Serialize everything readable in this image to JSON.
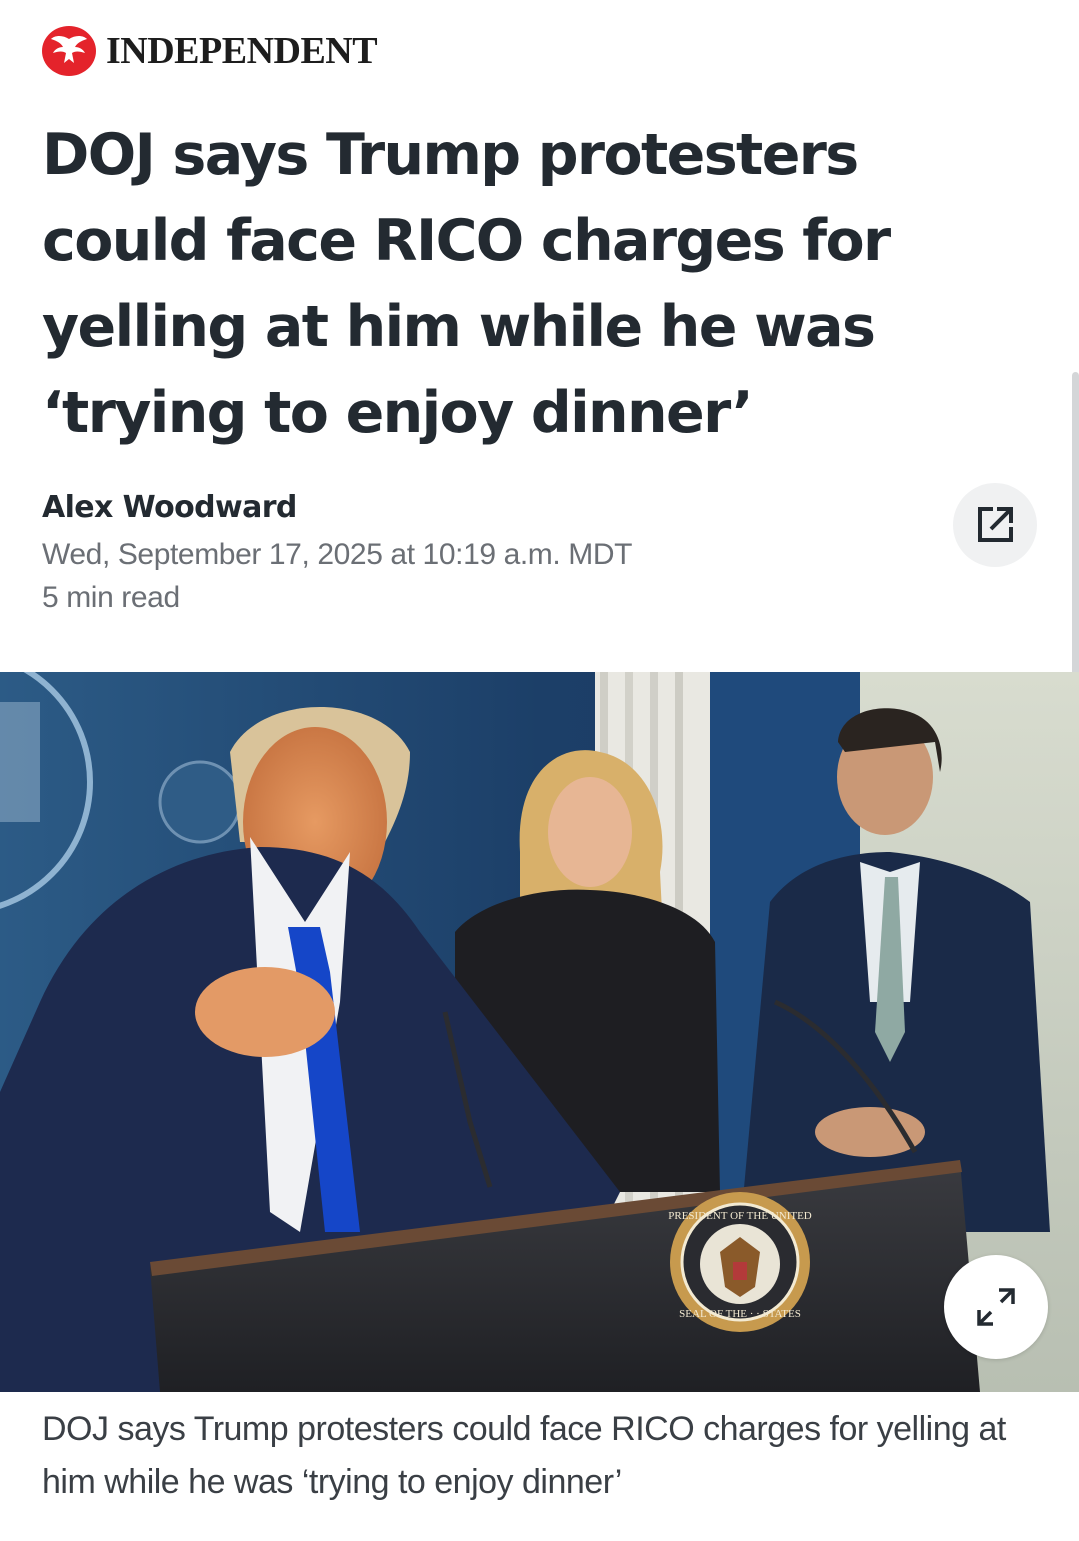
{
  "publisher": {
    "name": "INDEPENDENT",
    "logo_icon": "eagle-icon",
    "brand_color": "#e4232b"
  },
  "article": {
    "headline": "DOJ says Trump protesters could face RICO charges for yelling at him while he was ‘trying to enjoy dinner’",
    "author": "Alex Woodward",
    "published": "Wed, September 17, 2025 at 10:19 a.m. MDT",
    "read_time": "5 min read",
    "share_icon": "external-link-icon"
  },
  "photo": {
    "alt": "DOJ says Trump protesters could face RICO charges for yelling at him while he was ‘trying to enjoy dinner’",
    "seal_top": "PRESIDENT OF THE UNITED",
    "seal_bottom": "SEAL OF THE · · STATES",
    "expand_icon": "expand-arrows-icon"
  },
  "caption": "DOJ says Trump protesters could face RICO charges for yelling at him while he was ‘trying to enjoy dinner’"
}
